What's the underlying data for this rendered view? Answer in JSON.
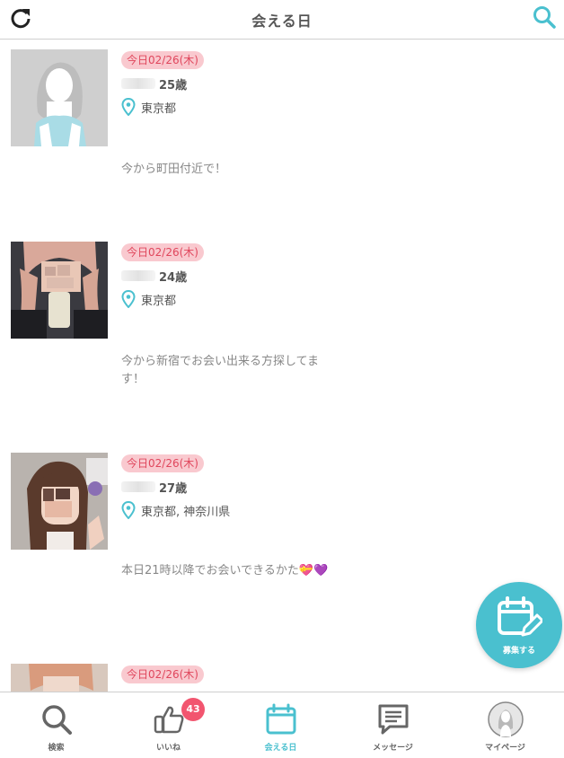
{
  "header": {
    "title": "会える日"
  },
  "posts": [
    {
      "date": "今日02/26(木)",
      "age": "25歳",
      "location": "東京都",
      "message": "今から町田付近で！"
    },
    {
      "date": "今日02/26(木)",
      "age": "24歳",
      "location": "東京都",
      "message": "今から新宿でお会い出来る方探してます！"
    },
    {
      "date": "今日02/26(木)",
      "age": "27歳",
      "location": "東京都, 神奈川県",
      "message": "本日21時以降でお会いできるかた💝💜"
    },
    {
      "date": "今日02/26(木)"
    }
  ],
  "fab": {
    "label": "募集する"
  },
  "nav": {
    "items": [
      {
        "label": "検索",
        "icon": "search-icon"
      },
      {
        "label": "いいね",
        "icon": "thumbs-up-icon",
        "badge": "43"
      },
      {
        "label": "会える日",
        "icon": "calendar-icon",
        "active": true
      },
      {
        "label": "メッセージ",
        "icon": "message-icon"
      },
      {
        "label": "マイページ",
        "icon": "user-avatar-icon"
      }
    ]
  },
  "colors": {
    "accent": "#4ac0cf",
    "badge": "#f2556f",
    "date_bg": "#f9c9cf",
    "date_text": "#e0475d"
  }
}
